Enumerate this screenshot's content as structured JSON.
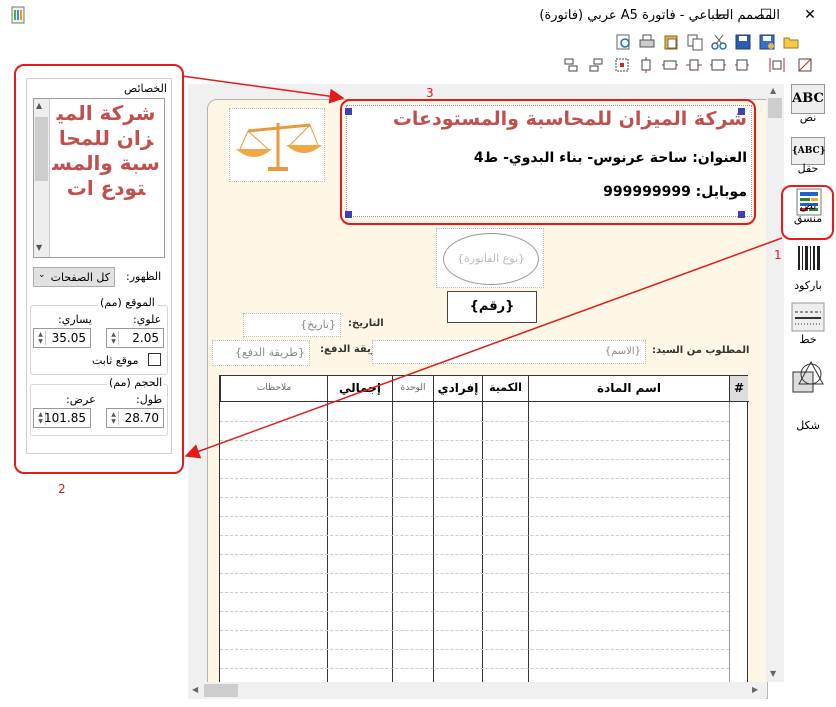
{
  "window": {
    "title": "المصمم الطباعي - فاتورة A5 عربي (فاتورة)",
    "minimize": "—",
    "maximize": "☐",
    "close": "✕"
  },
  "toolbar_top": [
    "print-preview-icon",
    "printer-icon",
    "paste-icon",
    "copy-icon",
    "cut-icon",
    "save-icon",
    "save-as-icon",
    "open-folder-icon"
  ],
  "toolbar_align": [
    "align-lefts-icon",
    "align-rights-icon",
    "center-icon",
    "center-vertical-icon",
    "align-tops-icon",
    "align-middles-icon",
    "align-bottoms-icon",
    "same-width-icon",
    "same-height-icon",
    "same-size-icon"
  ],
  "properties": {
    "header": "الخصائص",
    "preview_text": "شركة الميزان للمحاسبة والمستودع ات",
    "visibility_label": "الظهور:",
    "visibility_value": "كل الصفحات",
    "position_header": "الموقع (مم)",
    "top_label": "علوي:",
    "top_value": "2.05",
    "left_label": "يساري:",
    "left_value": "35.05",
    "fixed_label": "موقع ثابت",
    "size_header": "الحجم (مم)",
    "height_label": "طول:",
    "height_value": "28.70",
    "width_label": "عرض:",
    "width_value": "101.85"
  },
  "header_box": {
    "company": "شركة الميزان للمحاسبة والمستودعات",
    "address": "العنوان: ساحة عرنوس- بناء البدوي- ط4",
    "mobile": "موبايل: 999999999"
  },
  "invoice": {
    "type_field": "{نوع الفاتورة}",
    "number_field": "{رقم}",
    "date_label": "التاريخ:",
    "date_field": "{تاريخ}",
    "payment_label": "طريقة الدفع:",
    "payment_field": "{طريقة الدفع}",
    "customer_label": "المطلوب من السيد:",
    "customer_field": "{الاسم}",
    "columns": {
      "index": "#",
      "item": "اسم المادة",
      "qty": "الكمية",
      "unit_price": "إفرادي",
      "unit": "الوحدة",
      "total": "إجمالي",
      "notes": "ملاحظات"
    }
  },
  "tools": {
    "text": "نص",
    "field": "حقل",
    "formatted_text": "نص منسق",
    "barcode": "باركود",
    "line": "خط",
    "shape": "شكل",
    "text_icon": "ABC",
    "field_icon": "{ABC}"
  },
  "annotations": {
    "one": "1",
    "two": "2",
    "three": "3"
  },
  "colors": {
    "accent_red": "#e21b1b",
    "company_text": "#c0504d",
    "page_bg": "#fef7e6"
  }
}
